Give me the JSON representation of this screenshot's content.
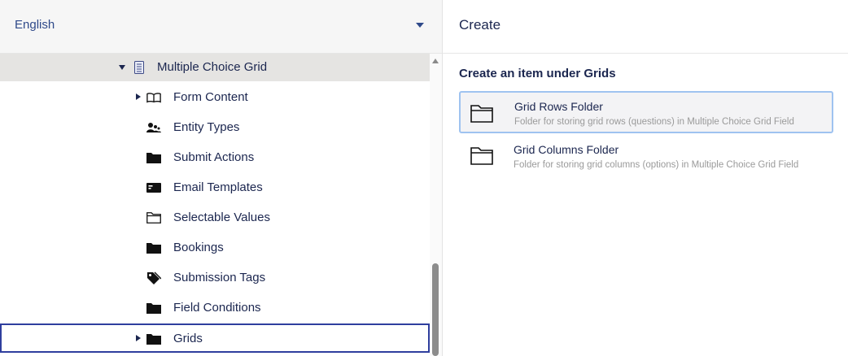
{
  "language": {
    "selected": "English"
  },
  "tree": {
    "parent": {
      "label": "Multiple Choice Grid"
    },
    "items": [
      {
        "label": "Form Content"
      },
      {
        "label": "Entity Types"
      },
      {
        "label": "Submit Actions"
      },
      {
        "label": "Email Templates"
      },
      {
        "label": "Selectable Values"
      },
      {
        "label": "Bookings"
      },
      {
        "label": "Submission Tags"
      },
      {
        "label": "Field Conditions"
      },
      {
        "label": "Grids"
      }
    ]
  },
  "create_panel": {
    "title": "Create",
    "section_title": "Create an item under Grids",
    "options": [
      {
        "name": "Grid Rows Folder",
        "description": "Folder for storing grid rows (questions) in Multiple Choice Grid Field"
      },
      {
        "name": "Grid Columns Folder",
        "description": "Folder for storing grid columns (options) in Multiple Choice Grid Field"
      }
    ]
  },
  "colors": {
    "accent": "#2f3e9e",
    "text": "#1b264f",
    "highlight_border": "#9fc3f0"
  }
}
